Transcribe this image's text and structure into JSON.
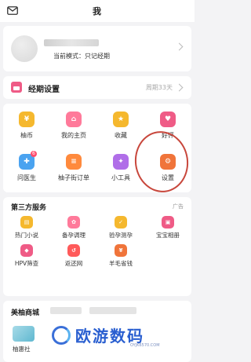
{
  "header": {
    "title": "我"
  },
  "profile": {
    "mode_text": "当前模式：只记经期"
  },
  "period": {
    "label": "经期设置",
    "value": "周期33天"
  },
  "tools": [
    {
      "label": "柚币",
      "icon": "coin-icon",
      "color": "#f5b82e",
      "glyph": "¥"
    },
    {
      "label": "我的主页",
      "icon": "home-icon",
      "color": "#ff7a9a",
      "glyph": "⌂"
    },
    {
      "label": "收藏",
      "icon": "star-icon",
      "color": "#f5b82e",
      "glyph": "★"
    },
    {
      "label": "好评",
      "icon": "heart-icon",
      "color": "#ef5b86",
      "glyph": "♥"
    },
    {
      "label": "问医生",
      "icon": "doctor-icon",
      "color": "#4aa3f0",
      "glyph": "✚",
      "badge": "6"
    },
    {
      "label": "柚子街订单",
      "icon": "order-icon",
      "color": "#ff8a3d",
      "glyph": "≡"
    },
    {
      "label": "小工具",
      "icon": "tools-icon",
      "color": "#b06ee8",
      "glyph": "✦"
    },
    {
      "label": "设置",
      "icon": "gear-icon",
      "color": "#f0743a",
      "glyph": "⚙"
    }
  ],
  "third": {
    "title": "第三方服务",
    "ad": "广告",
    "items": [
      {
        "label": "热门小说",
        "icon": "book-icon",
        "color": "#f5b82e",
        "glyph": "▤"
      },
      {
        "label": "备孕调理",
        "icon": "flower-icon",
        "color": "#ff7a9a",
        "glyph": "✿"
      },
      {
        "label": "验孕测孕",
        "icon": "test-icon",
        "color": "#f5b82e",
        "glyph": "✓"
      },
      {
        "label": "宝宝相册",
        "icon": "album-icon",
        "color": "#ef5b86",
        "glyph": "▣"
      },
      {
        "label": "HPV筛查",
        "icon": "shield-icon",
        "color": "#ef5b86",
        "glyph": "◆"
      },
      {
        "label": "返还网",
        "icon": "return-icon",
        "color": "#ff5a5a",
        "glyph": "↺"
      },
      {
        "label": "羊毛省钱",
        "icon": "saving-icon",
        "color": "#f0743a",
        "glyph": "¥"
      }
    ]
  },
  "mall": {
    "title": "美柚商城",
    "product_label": "柚惠社"
  },
  "watermark": {
    "text": "欧游数码",
    "url": "OYJK6570.COM"
  }
}
